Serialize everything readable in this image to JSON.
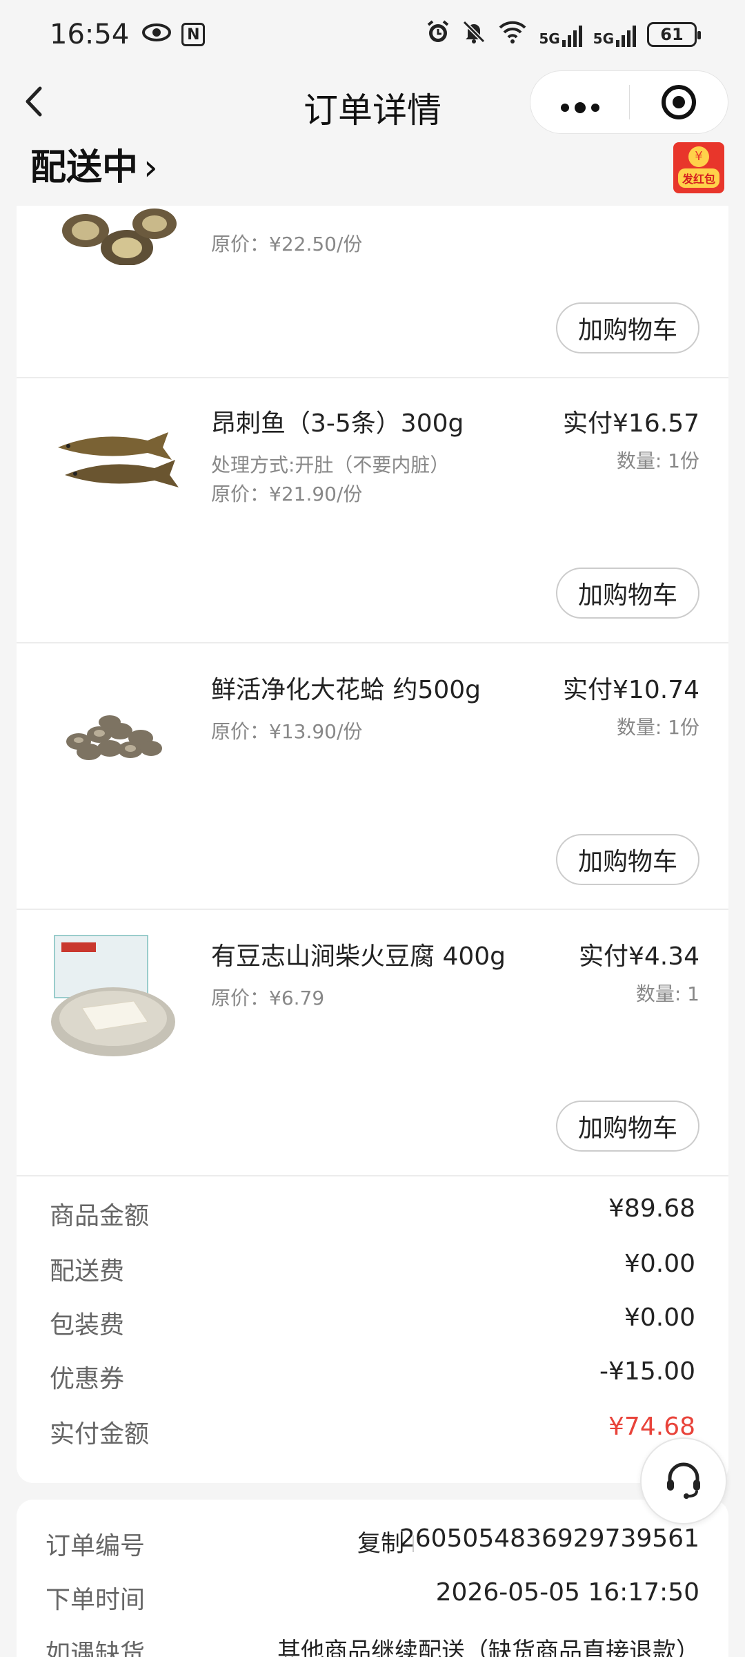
{
  "status_bar": {
    "time": "16:54",
    "battery": "61",
    "network1": "5G",
    "network2": "5G",
    "nfc": "N"
  },
  "nav": {
    "back": "‹",
    "title": "订单详情",
    "more": "•••"
  },
  "order_status": {
    "label": "配送中",
    "chevron": "›"
  },
  "red_packet": {
    "label": "发红包",
    "coin": "¥"
  },
  "items": [
    {
      "name": "",
      "option": "",
      "original_price": "原价：¥22.50/份",
      "paid": "",
      "qty": "",
      "add_cart": "加购物车"
    },
    {
      "name": "昂刺鱼（3-5条）300g",
      "option": "处理方式:开肚（不要内脏）",
      "original_price": "原价：¥21.90/份",
      "paid": "实付¥16.57",
      "qty": "数量: 1份",
      "add_cart": "加购物车"
    },
    {
      "name": "鲜活净化大花蛤 约500g",
      "option": "",
      "original_price": "原价：¥13.90/份",
      "paid": "实付¥10.74",
      "qty": "数量: 1份",
      "add_cart": "加购物车"
    },
    {
      "name": "有豆志山涧柴火豆腐 400g",
      "option": "",
      "original_price": "原价：¥6.79",
      "paid": "实付¥4.34",
      "qty": "数量: 1",
      "add_cart": "加购物车"
    }
  ],
  "summary": {
    "goods_label": "商品金额",
    "goods_value": "¥89.68",
    "delivery_label": "配送费",
    "delivery_value": "¥0.00",
    "packing_label": "包装费",
    "packing_value": "¥0.00",
    "coupon_label": "优惠券",
    "coupon_value": "-¥15.00",
    "total_label": "实付金额",
    "total_value": "¥74.68",
    "total_color": "#e8433a"
  },
  "order_info": {
    "number_label": "订单编号",
    "copy": "复制",
    "number_value": "2605054836929739561",
    "time_label": "下单时间",
    "time_value": "2026-05-05 16:17:50",
    "stockout_label": "如遇缺货",
    "stockout_value": "其他商品继续配送（缺货商品直接退款）"
  },
  "icons": {
    "back": "chevron-left-icon",
    "more": "more-dots-icon",
    "target": "target-icon",
    "service": "customer-service-icon"
  }
}
